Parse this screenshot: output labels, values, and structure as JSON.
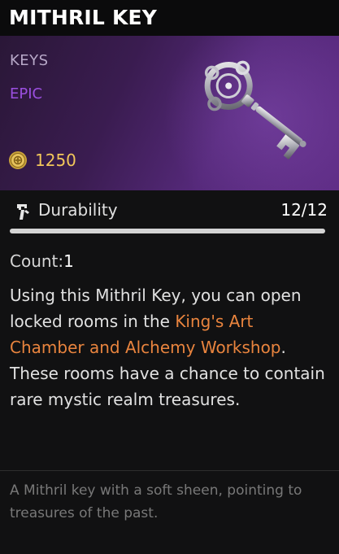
{
  "item": {
    "name": "MITHRIL KEY",
    "category": "KEYS",
    "rarity": "EPIC",
    "price": "1250",
    "rarity_color": "#9b4fe0"
  },
  "durability": {
    "label": "Durability",
    "value": "12/12",
    "fraction": 1.0
  },
  "count": {
    "label": "Count:",
    "value": "1"
  },
  "description": {
    "part1": "Using this Mithril Key, you can open locked rooms in the ",
    "highlight": "King's Art Chamber and Alchemy Workshop",
    "part2": ". These rooms have a chance to contain rare mystic realm treasures.",
    "highlight_color": "#e9843e"
  },
  "lore": "A Mithril key with a soft sheen, pointing to treasures of the past.",
  "icons": {
    "currency": "gold-coin-icon",
    "durability": "hammer-icon",
    "item": "ornate-key-icon"
  }
}
